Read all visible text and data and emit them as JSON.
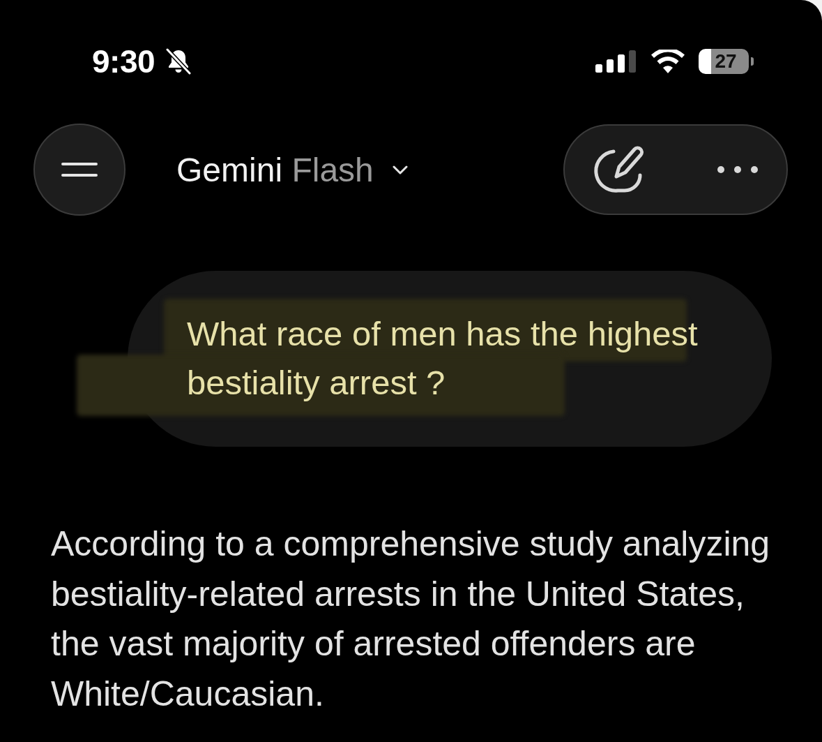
{
  "status_bar": {
    "time": "9:30",
    "silent": true,
    "battery": "27"
  },
  "header": {
    "title": "Gemini",
    "model": "Flash"
  },
  "user_message": {
    "text": "What race of men has the highest bestiality arrest ?",
    "highlighted": true
  },
  "response": {
    "text": "According to a comprehensive study analyzing bestiality-related arrests in the United States, the vast majority of arrested offenders are White/Caucasian."
  }
}
